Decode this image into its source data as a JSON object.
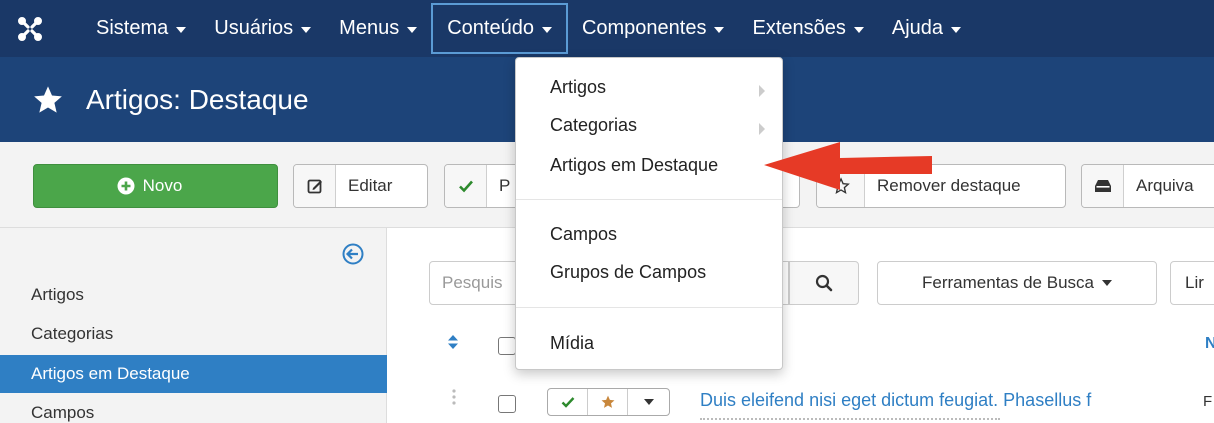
{
  "topnav": {
    "items": [
      {
        "label": "Sistema"
      },
      {
        "label": "Usuários"
      },
      {
        "label": "Menus"
      },
      {
        "label": "Conteúdo"
      },
      {
        "label": "Componentes"
      },
      {
        "label": "Extensões"
      },
      {
        "label": "Ajuda"
      }
    ]
  },
  "header": {
    "title": "Artigos: Destaque"
  },
  "toolbar": {
    "new_label": "Novo",
    "edit_label": "Editar",
    "publish_label": "P",
    "unfeature_label": "Remover destaque",
    "archive_label": "Arquiva"
  },
  "sidebar": {
    "items": [
      {
        "label": "Artigos"
      },
      {
        "label": "Categorias"
      },
      {
        "label": "Artigos em Destaque"
      },
      {
        "label": "Campos"
      }
    ]
  },
  "search": {
    "placeholder": "Pesquis",
    "tools_label": "Ferramentas de Busca",
    "limit_label": "Lir"
  },
  "table": {
    "header_col_n": "N",
    "rows": [
      {
        "title": "Duis eleifend nisi eget dictum feugiat. Phasellus f",
        "col_f": "F"
      }
    ]
  },
  "dropdown": {
    "items": [
      {
        "label": "Artigos"
      },
      {
        "label": "Categorias"
      },
      {
        "label": "Artigos em Destaque"
      },
      {
        "label": "Campos"
      },
      {
        "label": "Grupos de Campos"
      },
      {
        "label": "Mídia"
      }
    ]
  },
  "colors": {
    "topnav": "#1a3867",
    "titlebar": "#1d4479",
    "accent": "#2f7fc4",
    "success": "#4ba64a",
    "arrow": "#e63a26"
  }
}
